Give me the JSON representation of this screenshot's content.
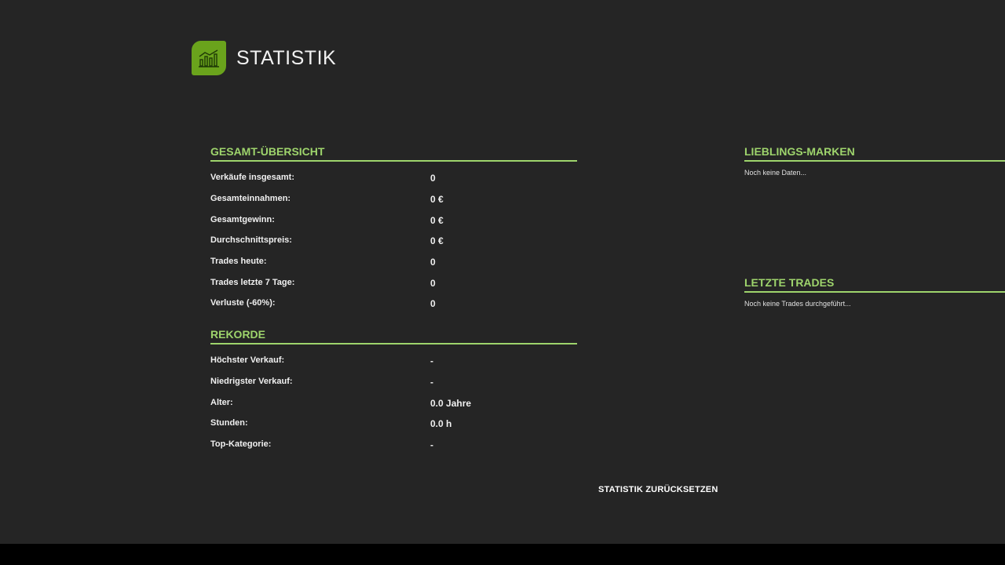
{
  "header": {
    "title": "STATISTIK",
    "logo_icon": "bar-chart-icon",
    "accent": "#6aa31c"
  },
  "overview": {
    "title": "GESAMT-ÜBERSICHT",
    "rows": [
      {
        "label": "Verkäufe insgesamt:",
        "value": "0"
      },
      {
        "label": "Gesamteinnahmen:",
        "value": "0 €"
      },
      {
        "label": "Gesamtgewinn:",
        "value": "0 €"
      },
      {
        "label": "Durchschnittspreis:",
        "value": "0 €"
      },
      {
        "label": "Trades heute:",
        "value": "0"
      },
      {
        "label": "Trades letzte 7 Tage:",
        "value": "0"
      },
      {
        "label": "Verluste (-60%):",
        "value": "0"
      }
    ]
  },
  "records": {
    "title": "REKORDE",
    "rows": [
      {
        "label": "Höchster Verkauf:",
        "value": "-"
      },
      {
        "label": "Niedrigster Verkauf:",
        "value": "-"
      },
      {
        "label": "Alter:",
        "value": "0.0 Jahre"
      },
      {
        "label": "Stunden:",
        "value": "0.0 h"
      },
      {
        "label": "Top-Kategorie:",
        "value": "-"
      }
    ]
  },
  "favorite_brands": {
    "title": "LIEBLINGS-MARKEN",
    "empty_text": "Noch keine Daten..."
  },
  "recent_trades": {
    "title": "LETZTE TRADES",
    "empty_text": "Noch keine Trades durchgeführt..."
  },
  "actions": {
    "reset_label": "STATISTIK ZURÜCKSETZEN"
  },
  "colors": {
    "background": "#252525",
    "section_accent": "#9ed46c"
  }
}
